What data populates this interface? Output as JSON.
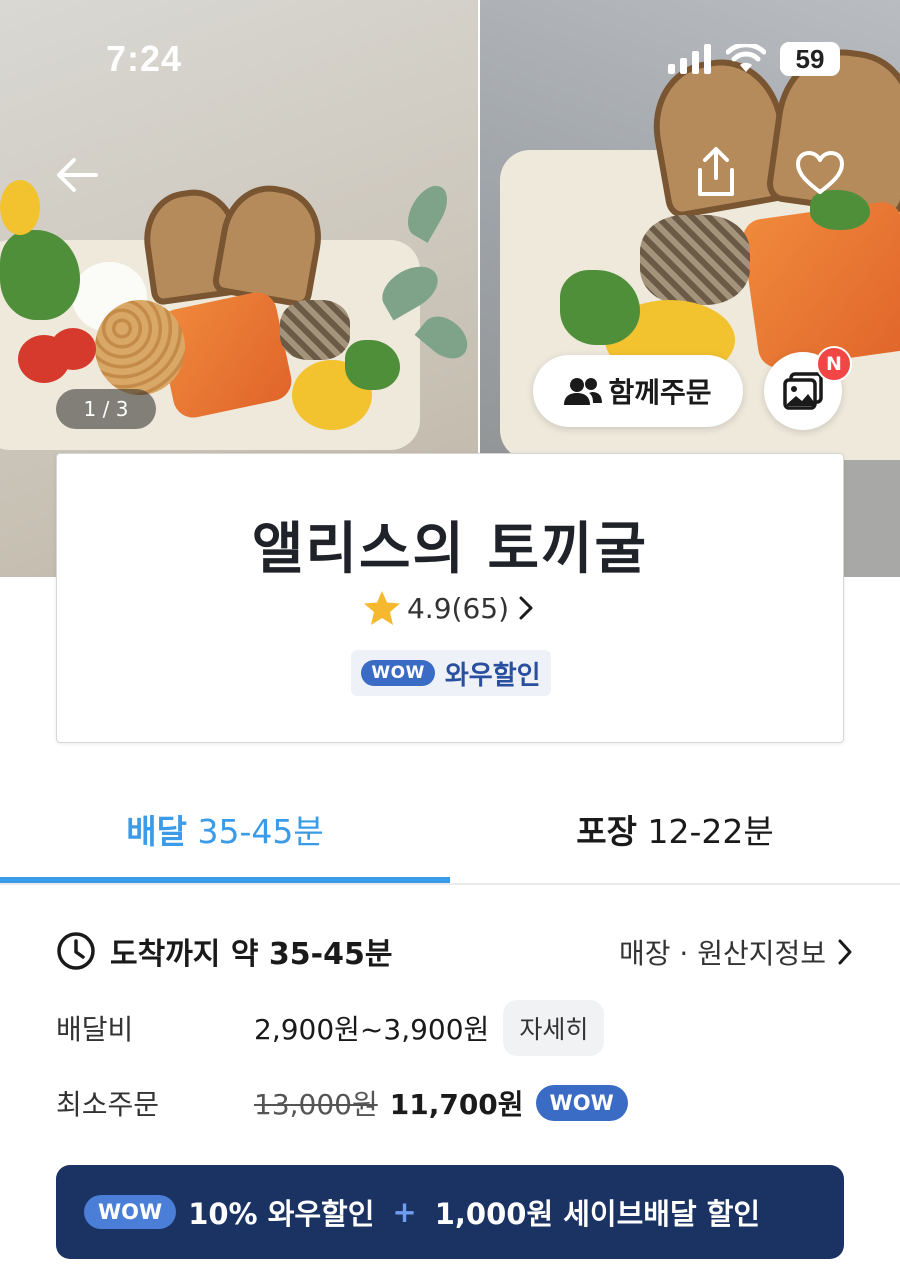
{
  "status_bar": {
    "time": "7:24",
    "battery": "59",
    "icons": [
      "cellular-signal-icon",
      "wifi-icon",
      "battery-icon"
    ]
  },
  "hero": {
    "counter": "1 / 3",
    "group_order_label": "함께주문",
    "photo_review_badge": "N",
    "icons": [
      "back-arrow-icon",
      "share-icon",
      "heart-icon",
      "people-icon",
      "photo-gallery-icon"
    ]
  },
  "store": {
    "name": "앨리스의 토끼굴",
    "rating": "4.9(65)",
    "wow_badge": "WOW",
    "wow_label": "와우할인"
  },
  "tabs": [
    {
      "label": "배달",
      "time": "35-45분",
      "active": true
    },
    {
      "label": "포장",
      "time": "12-22분",
      "active": false
    }
  ],
  "delivery": {
    "arrival": "도착까지 약 35-45분",
    "store_info_link": "매장 · 원산지정보",
    "fee_label": "배달비",
    "fee_value": "2,900원~3,900원",
    "fee_detail_button": "자세히",
    "min_order_label": "최소주문",
    "min_order_original": "13,000원",
    "min_order_discounted": "11,700원",
    "min_order_badge": "WOW"
  },
  "promo": {
    "badge": "WOW",
    "text1": "10% 와우할인",
    "plus": "+",
    "text2": "1,000원 세이브배달 할인"
  },
  "colors": {
    "accent_blue": "#3a9be8",
    "wow_blue": "#3a6cc6",
    "promo_navy": "#1a3363",
    "star": "#f5b82e",
    "new_badge": "#f04646"
  }
}
